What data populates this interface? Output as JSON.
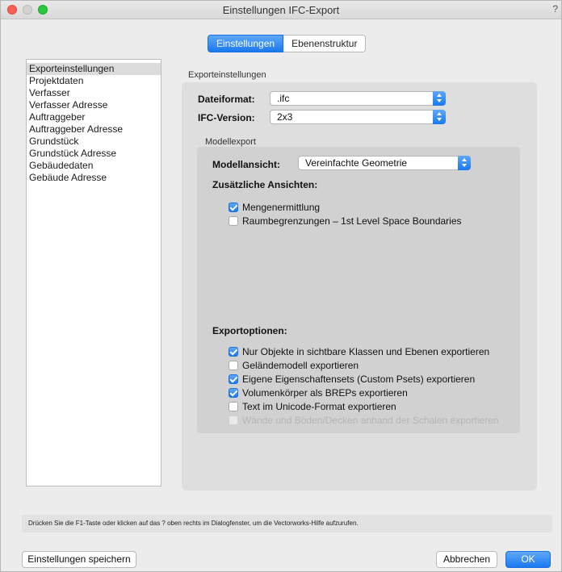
{
  "window": {
    "title": "Einstellungen IFC-Export",
    "corner_mark": "?"
  },
  "tabs": [
    {
      "label": "Einstellungen"
    },
    {
      "label": "Ebenenstruktur"
    }
  ],
  "sidebar": {
    "items": [
      {
        "label": "Exporteinstellungen"
      },
      {
        "label": "Projektdaten"
      },
      {
        "label": "Verfasser"
      },
      {
        "label": "Verfasser Adresse"
      },
      {
        "label": "Auftraggeber"
      },
      {
        "label": "Auftraggeber Adresse"
      },
      {
        "label": "Grundstück"
      },
      {
        "label": "Grundstück Adresse"
      },
      {
        "label": "Gebäudedaten"
      },
      {
        "label": "Gebäude Adresse"
      }
    ]
  },
  "export_settings": {
    "group_title": "Exporteinstellungen",
    "dateiformat_label": "Dateiformat:",
    "dateiformat_value": ".ifc",
    "ifc_version_label": "IFC-Version:",
    "ifc_version_value": "2x3",
    "modellexport_title": "Modellexport",
    "modellansicht_label": "Modellansicht:",
    "modellansicht_value": "Vereinfachte Geometrie",
    "zusaetzliche_label": "Zusätzliche Ansichten:",
    "views": [
      {
        "label": "Mengenermittlung",
        "checked": true
      },
      {
        "label": "Raumbegrenzungen – 1st Level Space Boundaries",
        "checked": false
      }
    ],
    "exportoptionen_label": "Exportoptionen:",
    "options": [
      {
        "label": "Nur Objekte in sichtbare Klassen und Ebenen exportieren",
        "checked": true
      },
      {
        "label": "Geländemodell exportieren",
        "checked": false
      },
      {
        "label": "Eigene Eigenschaftensets (Custom Psets) exportieren",
        "checked": true
      },
      {
        "label": "Volumenkörper als BREPs exportieren",
        "checked": true
      },
      {
        "label": "Text im Unicode-Format exportieren",
        "checked": false
      },
      {
        "label": "Wände und Böden/Decken anhand der Schalen exportieren",
        "checked": false,
        "disabled": true
      }
    ]
  },
  "hint": "Drücken Sie die F1-Taste oder klicken auf das ? oben rechts im Dialogfenster, um die Vectorworks-Hilfe aufzurufen.",
  "buttons": {
    "save": "Einstellungen speichern",
    "cancel": "Abbrechen",
    "ok": "OK"
  },
  "colors": {
    "accent": "#1a78ef"
  }
}
